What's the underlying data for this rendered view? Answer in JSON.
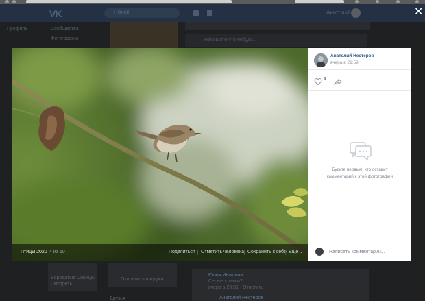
{
  "browser": {
    "url": "https://vk.com/photo-...",
    "search_placeholder": "Поиск"
  },
  "vk": {
    "search_placeholder": "Поиск",
    "user_name": "Анатолий",
    "left_menu": [
      "Сообщества",
      "Фотографии"
    ],
    "left_top_item": "Профиль",
    "wall_post_placeholder": "Напишите что-нибудь...",
    "bottom": {
      "promo_title": "Бородатые Синицы",
      "promo_sub": "Смотреть",
      "post_author": "Юлия Ивашова",
      "post_text": "Серые славки?",
      "post_meta": "вчера в 23:51 · Ответить",
      "gift_button": "Отправить подарок",
      "friends_label": "Друзья",
      "second_author": "Анатолий Нестеров"
    }
  },
  "viewer": {
    "close_label": "✕",
    "album": "Птицы 2020",
    "counter": "4 из 10",
    "actions": {
      "share": "Поделиться",
      "tag": "Отметить человека",
      "save": "Сохранить к себе",
      "more": "Ещё"
    }
  },
  "panel": {
    "author": "Анатолий Нестеров",
    "time": "вчера в 21:59",
    "likes": "4",
    "empty_line1": "Будьте первым, кто оставит",
    "empty_line2": "комментарий к этой фотографии",
    "comment_placeholder": "Написать комментарий..."
  },
  "colors": {
    "vk_link": "#2a5885",
    "vk_header": "#243144"
  }
}
